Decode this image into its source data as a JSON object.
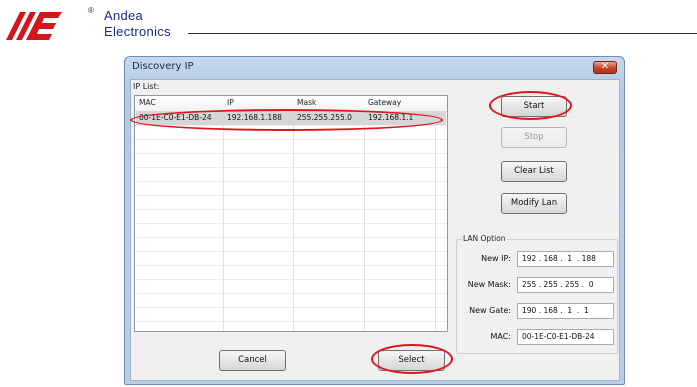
{
  "brand": {
    "name_line1": "Andea",
    "name_line2": "Electronics",
    "registered": "®",
    "logo_color": "#d4161c"
  },
  "dialog": {
    "title": "Discovery IP",
    "close_icon": "close-icon",
    "ip_list_label": "IP List:",
    "columns": [
      "MAC",
      "IP",
      "Mask",
      "Gateway"
    ],
    "rows": [
      {
        "mac": "00-1E-C0-E1-DB-24",
        "ip": "192.168.1.188",
        "mask": "255.255.255.0",
        "gateway": "192.168.1.1"
      }
    ],
    "buttons": {
      "start": "Start",
      "stop": "Stop",
      "clear_list": "Clear List",
      "modify_lan": "Modify Lan",
      "cancel": "Cancel",
      "select": "Select"
    },
    "lan_option": {
      "label": "LAN Option",
      "new_ip_label": "New IP:",
      "new_ip": "192 . 168 .  1  . 188",
      "new_mask_label": "New Mask:",
      "new_mask": "255 . 255 . 255 .  0",
      "new_gate_label": "New Gate:",
      "new_gate": "190 . 168 .  1  .  1",
      "mac_label": "MAC:",
      "mac": "00-1E-C0-E1-DB-24"
    }
  },
  "colors": {
    "highlight": "#e3121b",
    "title_bar": "#b9cfe8",
    "selected_row": "#d6d6d6"
  }
}
